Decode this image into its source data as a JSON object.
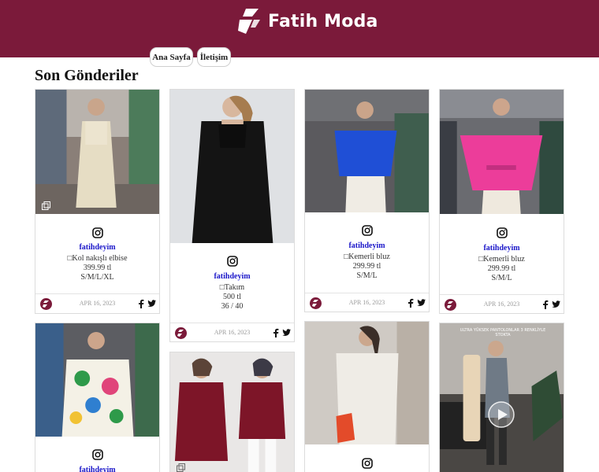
{
  "header": {
    "brand_name": "Fatih Moda",
    "bg_color": "#7b1a3a"
  },
  "nav": {
    "home_label": "Ana Sayfa",
    "contact_label": "İletişim"
  },
  "main": {
    "title": "Son Gönderiler"
  },
  "icons": {
    "instagram": "instagram-icon",
    "facebook": "facebook-icon",
    "twitter": "twitter-icon",
    "multi": "multi-image-icon",
    "play": "play-icon"
  },
  "posts": [
    {
      "user": "fatihdeyim",
      "lines": [
        "□Kol nakışlı elbise",
        "399.99 tl",
        "S/M/L/XL"
      ],
      "date": "APR 16, 2023"
    },
    {
      "user": "fatihdeyim",
      "lines": [
        "□Takım",
        "500 tl",
        "36 / 40"
      ],
      "date": "APR 16, 2023"
    },
    {
      "user": "fatihdeyim",
      "lines": [
        "□Kemerli bluz",
        "299.99 tl",
        "S/M/L"
      ],
      "date": "APR 16, 2023"
    },
    {
      "user": "fatihdeyim",
      "lines": [
        "□Kemerli bluz",
        "299.99 tl",
        "S/M/L"
      ],
      "date": "APR 16, 2023"
    },
    {
      "user": "fatihdeyim"
    },
    {},
    {},
    {
      "overlay_text": "ULTRA YÜKSEK PANTOLONLAR 3 RENKLİYLE STOKTA"
    }
  ]
}
